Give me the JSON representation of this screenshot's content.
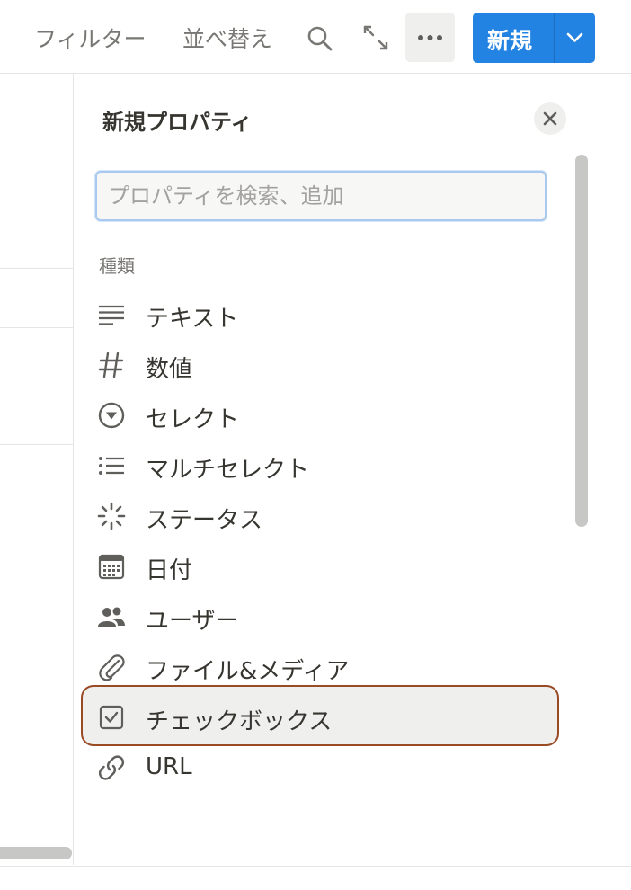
{
  "toolbar": {
    "filter_label": "フィルター",
    "sort_label": "並べ替え",
    "search_icon": "search-icon",
    "expand_icon": "expand-icon",
    "more_icon": "ellipsis-icon",
    "new_label": "新規",
    "new_chevron_icon": "chevron-down-icon",
    "accent_color": "#2383e2"
  },
  "panel": {
    "title": "新規プロパティ",
    "close_icon": "close-icon",
    "search_placeholder": "プロパティを検索、追加",
    "section_label": "種類",
    "items": [
      {
        "label": "テキスト",
        "icon": "text-lines-icon"
      },
      {
        "label": "数値",
        "icon": "hash-icon"
      },
      {
        "label": "セレクト",
        "icon": "select-circle-icon"
      },
      {
        "label": "マルチセレクト",
        "icon": "list-icon"
      },
      {
        "label": "ステータス",
        "icon": "status-spinner-icon"
      },
      {
        "label": "日付",
        "icon": "calendar-icon"
      },
      {
        "label": "ユーザー",
        "icon": "users-icon"
      },
      {
        "label": "ファイル&メディア",
        "icon": "paperclip-icon"
      },
      {
        "label": "チェックボックス",
        "icon": "checkbox-icon",
        "highlighted": true
      },
      {
        "label": "URL",
        "icon": "link-icon"
      }
    ]
  }
}
